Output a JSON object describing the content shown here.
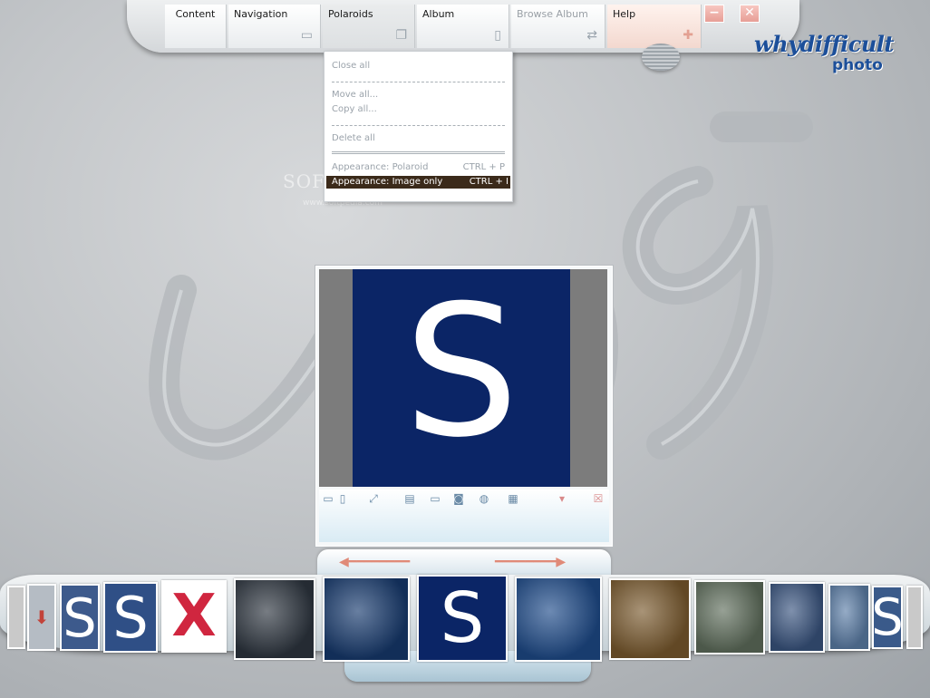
{
  "menu": {
    "items": [
      {
        "label": "Content"
      },
      {
        "label": "Navigation"
      },
      {
        "label": "Polaroids"
      },
      {
        "label": "Album"
      },
      {
        "label": "Browse Album"
      },
      {
        "label": "Help"
      }
    ],
    "minimize_symbol": "−",
    "close_symbol": "✕"
  },
  "brand": {
    "name": "whydifficult",
    "sub": "photo"
  },
  "polaroids_menu": {
    "close_all": "Close all",
    "separator": "------------------------------------------------",
    "move_all": "Move all...",
    "copy_all": "Copy all...",
    "delete_all": "Delete all",
    "separator2": "================================",
    "appearance_polaroid": "Appearance: Polaroid",
    "appearance_polaroid_shortcut": "CTRL + P",
    "appearance_image_only": "Appearance: Image only",
    "appearance_image_only_shortcut": "CTRL + I"
  },
  "watermark": {
    "text": "SOFTPEDIA",
    "sub": "www.softpedia.com"
  },
  "viewer": {
    "image_letter": "S"
  },
  "filmstrip": {
    "thumbs": [
      {
        "kind": "s",
        "letter": "S",
        "bg": "#3d5a8c"
      },
      {
        "kind": "s",
        "letter": "S",
        "bg": "#2f4f86"
      },
      {
        "kind": "x",
        "letter": "X",
        "bg": "#ffffff",
        "color": "#d0263f"
      },
      {
        "kind": "photo",
        "bg": "#2e3640"
      },
      {
        "kind": "photo",
        "bg": "#173a6e"
      },
      {
        "kind": "s",
        "letter": "S",
        "bg": "#0b2566"
      },
      {
        "kind": "photo",
        "bg": "#1e4b8a"
      },
      {
        "kind": "photo",
        "bg": "#7a5a2e"
      },
      {
        "kind": "photo",
        "bg": "#5f6e5c"
      },
      {
        "kind": "photo",
        "bg": "#3a5580"
      },
      {
        "kind": "photo",
        "bg": "#5d7fa8"
      },
      {
        "kind": "s",
        "letter": "S",
        "bg": "#3a5a8a"
      }
    ]
  }
}
